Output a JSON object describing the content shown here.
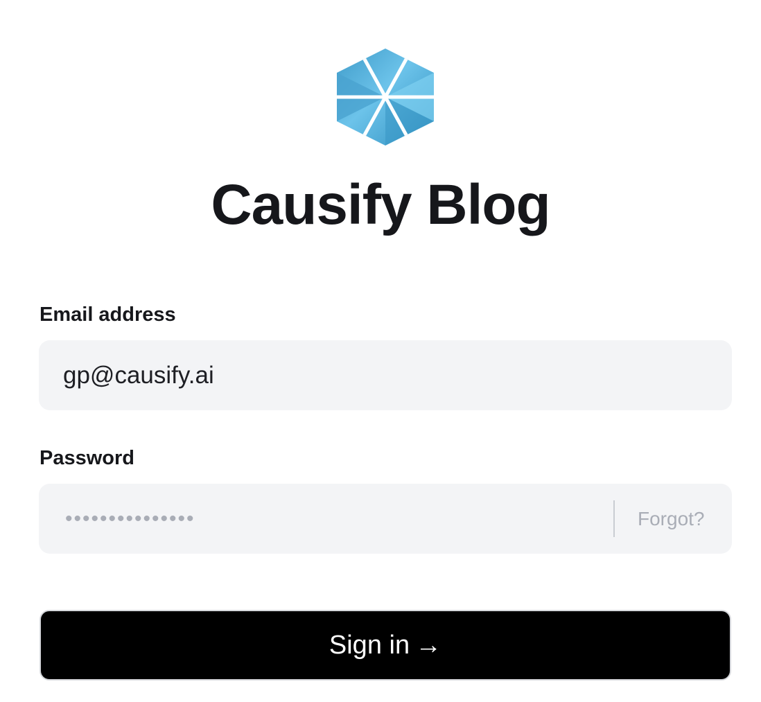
{
  "brand": {
    "logo_icon": "hexagon-asterisk-icon",
    "logo_color": "#5ab3d8",
    "title": "Causify Blog"
  },
  "form": {
    "email": {
      "label": "Email address",
      "value": "gp@causify.ai"
    },
    "password": {
      "label": "Password",
      "masked_value": "•••••••••••••••",
      "forgot_label": "Forgot?"
    },
    "submit": {
      "label": "Sign in",
      "arrow_icon": "→"
    }
  }
}
